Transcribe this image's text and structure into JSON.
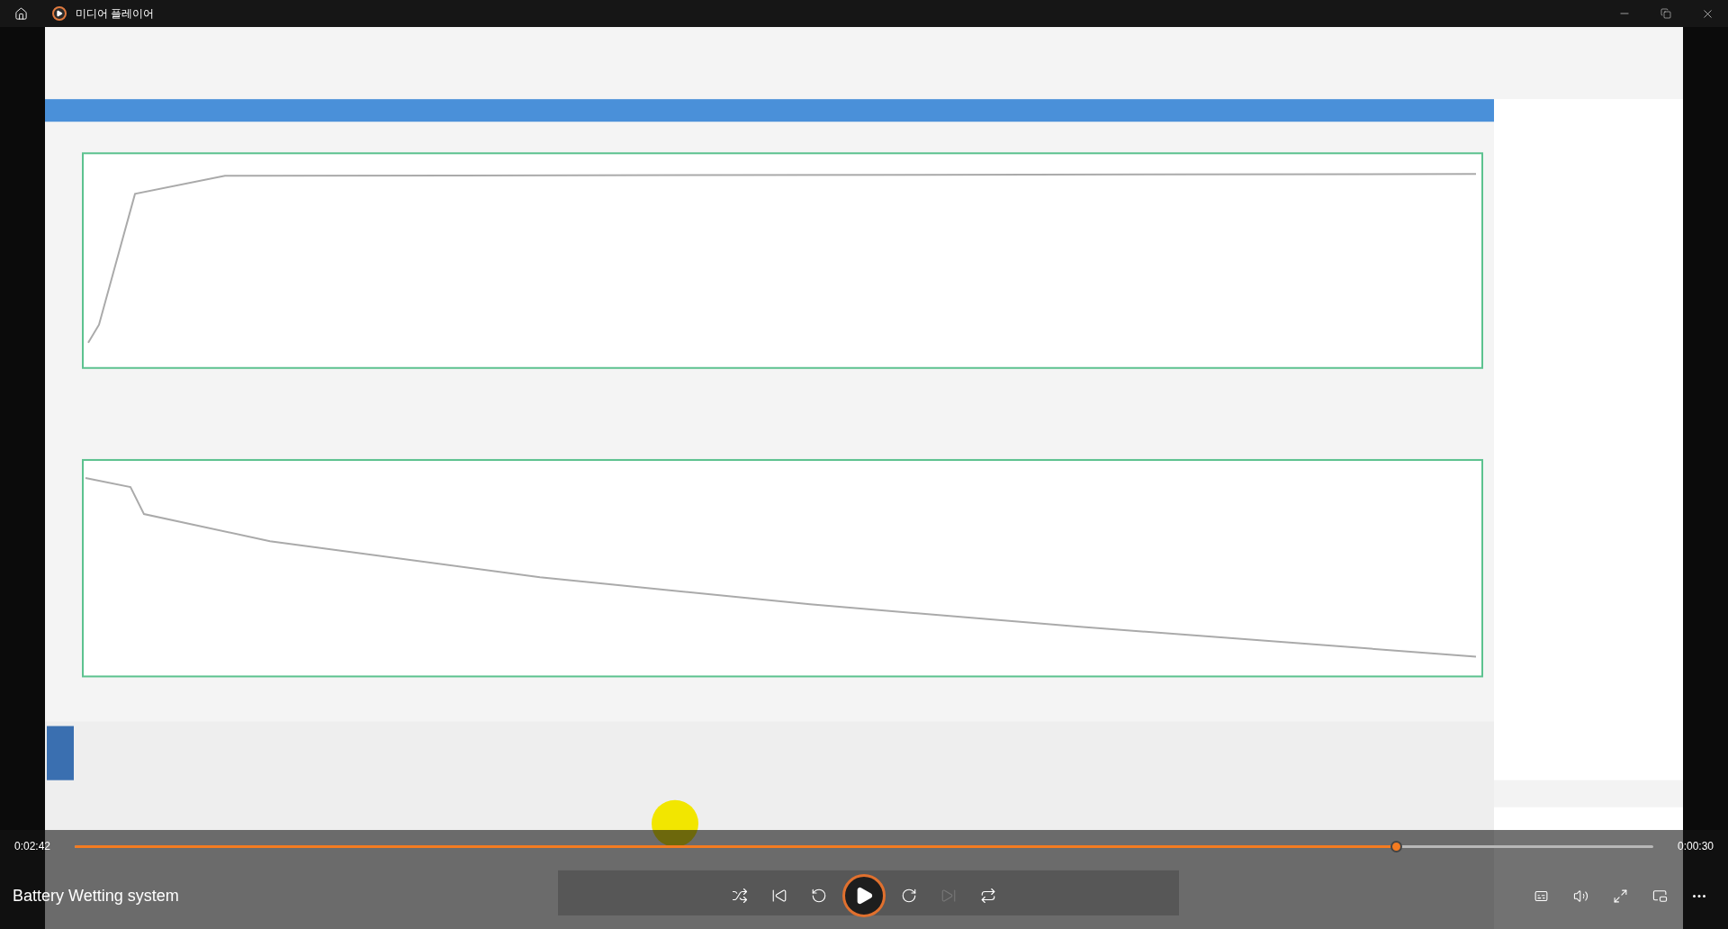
{
  "title_bar": {
    "title": "미디어 플레이어"
  },
  "player": {
    "elapsed": "0:02:42",
    "remaining": "0:00:30",
    "progress": {
      "level": 0.837
    },
    "media_title": "Battery Wetting system",
    "controls": [
      {
        "kind": "shuffle",
        "disabled": false
      },
      {
        "kind": "previous",
        "disabled": false
      },
      {
        "kind": "rewind",
        "disabled": false
      },
      {
        "kind": "play",
        "disabled": false
      },
      {
        "kind": "forward",
        "disabled": false
      },
      {
        "kind": "next",
        "disabled": true
      },
      {
        "kind": "repeat",
        "disabled": false
      }
    ],
    "right_controls": [
      {
        "kind": "captions"
      },
      {
        "kind": "volume"
      },
      {
        "kind": "fullscreen"
      },
      {
        "kind": "miniplayer"
      },
      {
        "kind": "more"
      }
    ]
  }
}
